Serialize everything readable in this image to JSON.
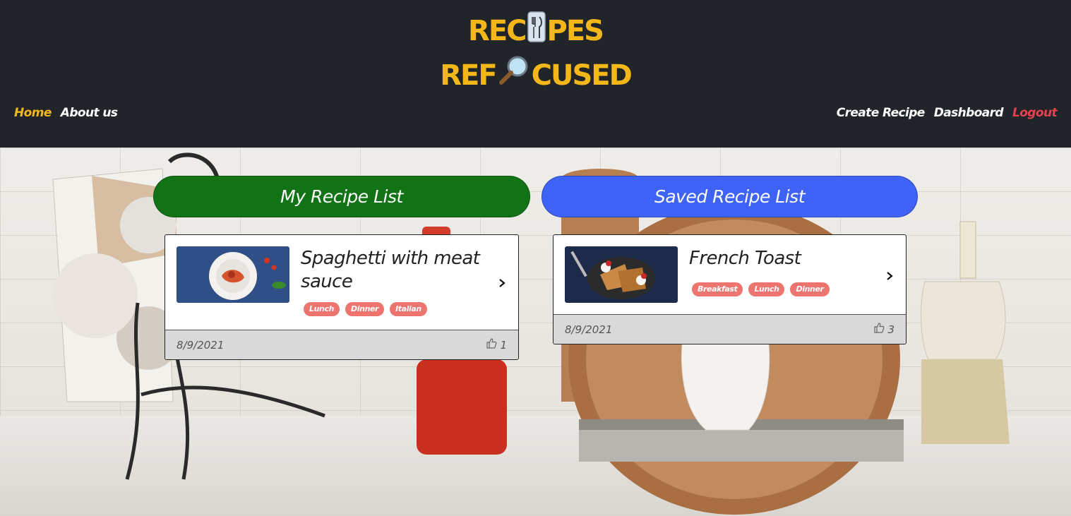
{
  "header": {
    "logo_line1_a": "REC",
    "logo_line1_b": "PES",
    "logo_line2_a": "REF",
    "logo_line2_b": "CUSED",
    "logo_icon1": "fork-knife-icon",
    "logo_icon2": "magnifying-glass-icon",
    "nav_left": [
      {
        "label": "Home",
        "active": true
      },
      {
        "label": "About us",
        "active": false
      }
    ],
    "nav_right": [
      {
        "label": "Create Recipe"
      },
      {
        "label": "Dashboard"
      },
      {
        "label": "Logout"
      }
    ],
    "colors": {
      "brand": "#f4b71a",
      "logout": "#e6414f",
      "bar": "#212429"
    }
  },
  "my_list": {
    "title": "My Recipe List",
    "color": "#127316",
    "recipes": [
      {
        "title": "Spaghetti with meat sauce",
        "tags": [
          "Lunch",
          "Dinner",
          "Italian"
        ],
        "date": "8/9/2021",
        "likes": "1"
      }
    ]
  },
  "saved_list": {
    "title": "Saved Recipe List",
    "color": "#3f62f7",
    "recipes": [
      {
        "title": "French Toast",
        "tags": [
          "Breakfast",
          "Lunch",
          "Dinner"
        ],
        "date": "8/9/2021",
        "likes": "3"
      }
    ]
  },
  "tag_color": "#ee7470"
}
